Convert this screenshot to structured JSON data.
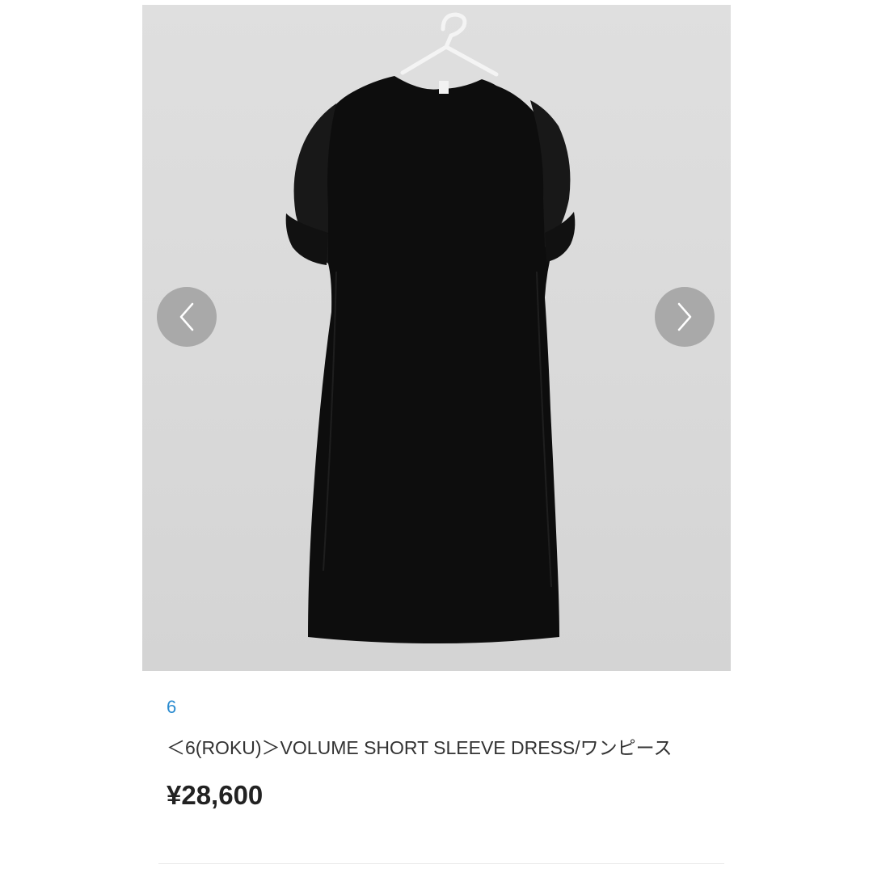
{
  "product": {
    "brand": "6",
    "title": "＜6(ROKU)＞VOLUME SHORT SLEEVE DRESS/ワンピース",
    "price": "¥28,600"
  },
  "gallery": {
    "prev_icon": "chevron-left-icon",
    "next_icon": "chevron-right-icon"
  },
  "colors": {
    "brand_link": "#2a8bd0",
    "photo_background": "#dcdcdc",
    "dress": "#0d0d0d"
  }
}
